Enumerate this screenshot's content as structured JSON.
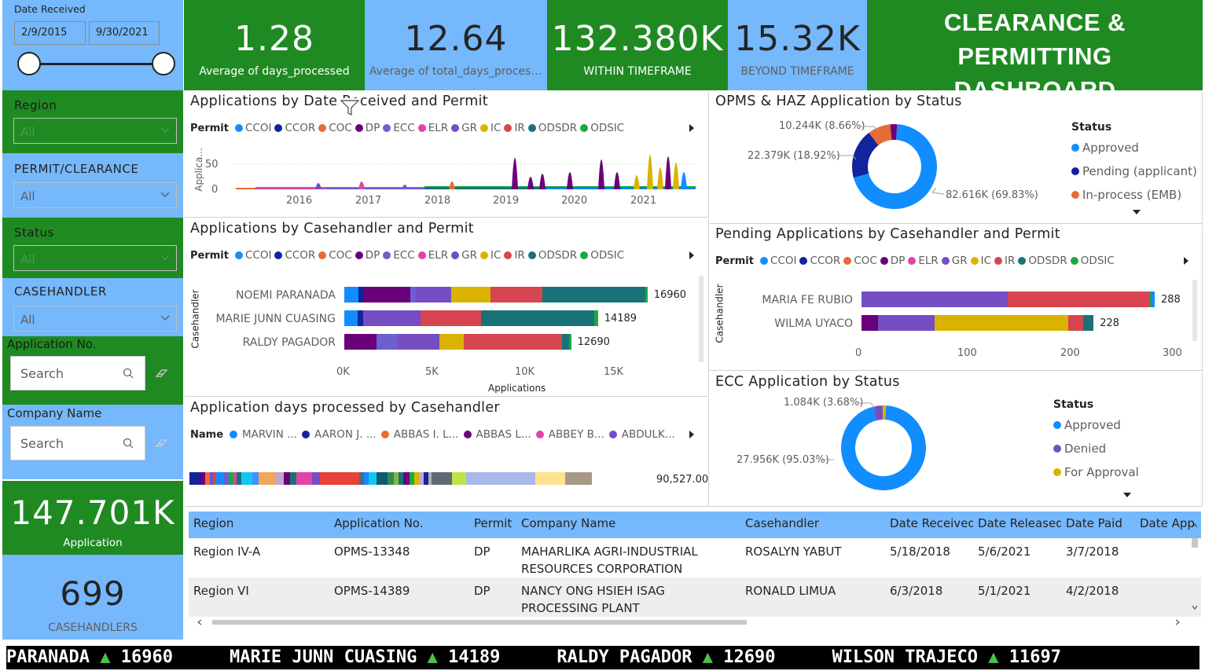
{
  "slicers": {
    "date": {
      "label": "Date Received",
      "start": "2/9/2015",
      "end": "9/30/2021"
    },
    "region": {
      "label": "Region",
      "value": "All"
    },
    "permit": {
      "label": "PERMIT/CLEARANCE",
      "value": "All"
    },
    "status": {
      "label": "Status",
      "value": "All"
    },
    "casehandler": {
      "label": "CASEHANDLER",
      "value": "All"
    },
    "application_no": {
      "label": "Application No.",
      "placeholder": "Search"
    },
    "company_name": {
      "label": "Company Name",
      "placeholder": "Search"
    }
  },
  "kpis": {
    "avg_days": {
      "value": "1.28",
      "label": "Average of days_processed"
    },
    "avg_total_days": {
      "value": "12.64",
      "label": "Average of total_days_processed"
    },
    "within": {
      "value": "132.380K",
      "label": "WITHIN TIMEFRAME"
    },
    "beyond": {
      "value": "15.32K",
      "label": "BEYOND TIMEFRAME"
    },
    "applications": {
      "value": "147.701K",
      "label": "Application"
    },
    "casehandlers": {
      "value": "699",
      "label": "CASEHANDLERS"
    }
  },
  "dashboard_title": "CLEARANCE & PERMITTING DASHBOARD",
  "permit_colors": {
    "CCOI": "#118dff",
    "CCOR": "#12239e",
    "COC": "#e66c37",
    "DP": "#6b007b",
    "ECC": "#6c5fcf",
    "ELR": "#e044a7",
    "GR": "#744ec2",
    "IC": "#d9b300",
    "IR": "#d64550",
    "ODSDR": "#197278",
    "ODSIC": "#1aab40"
  },
  "chart_by_date": {
    "title": "Applications by Date Received and Permit",
    "legend_title": "Permit",
    "legend": [
      "CCOI",
      "CCOR",
      "COC",
      "DP",
      "ECC",
      "ELR",
      "GR",
      "IC",
      "IR",
      "ODSDR",
      "ODSIC"
    ],
    "ylabel": "Applica...",
    "yticks": [
      "50",
      "0"
    ],
    "xticks": [
      "2016",
      "2017",
      "2018",
      "2019",
      "2020",
      "2021"
    ]
  },
  "chart_casehandler": {
    "title": "Applications by Casehandler and Permit",
    "legend_title": "Permit",
    "legend": [
      "CCOI",
      "CCOR",
      "COC",
      "DP",
      "ECC",
      "ELR",
      "GR",
      "IC",
      "IR",
      "ODSDR",
      "ODSIC"
    ],
    "ylabel": "Casehandler",
    "xlabel": "Applications",
    "xticks": [
      "0K",
      "5K",
      "10K",
      "15K"
    ]
  },
  "chart_days": {
    "title": "Application days processed by Casehandler",
    "legend_title": "Name",
    "legend": [
      {
        "name": "MARVIN ...",
        "color": "#118dff"
      },
      {
        "name": "AARON J. ...",
        "color": "#12239e"
      },
      {
        "name": "ABBAS I. L...",
        "color": "#e66c37"
      },
      {
        "name": "ABBAS L...",
        "color": "#6b007b"
      },
      {
        "name": "ABBEY B...",
        "color": "#e044a7"
      },
      {
        "name": "ABDULK...",
        "color": "#744ec2"
      }
    ],
    "total_label": "90,527.00"
  },
  "chart_opms": {
    "title": "OPMS & HAZ Application by Status",
    "legend_title": "Status",
    "legend": [
      {
        "name": "Approved",
        "color": "#118dff"
      },
      {
        "name": "Pending (applicant)",
        "color": "#12239e"
      },
      {
        "name": "In-process (EMB)",
        "color": "#e66c37"
      }
    ],
    "labels": [
      "10.244K (8.66%)",
      "22.379K (18.92%)",
      "82.616K (69.83%)"
    ]
  },
  "chart_pending": {
    "title": "Pending Applications by Casehandler and Permit",
    "legend_title": "Permit",
    "legend": [
      "CCOI",
      "CCOR",
      "COC",
      "DP",
      "ELR",
      "GR",
      "IC",
      "IR",
      "ODSDR",
      "ODSIC"
    ],
    "ylabel": "Casehandler",
    "xticks": [
      "0",
      "100",
      "200",
      "300"
    ]
  },
  "chart_ecc": {
    "title": "ECC Application by Status",
    "legend_title": "Status",
    "legend": [
      {
        "name": "Approved",
        "color": "#118dff"
      },
      {
        "name": "Denied",
        "color": "#744ec2"
      },
      {
        "name": "For Approval",
        "color": "#d9b300"
      }
    ],
    "labels": [
      "1.084K (3.68%)",
      "27.956K (95.03%)"
    ]
  },
  "chart_data": [
    {
      "type": "bar",
      "title": "Applications by Casehandler and Permit",
      "orientation": "horizontal-stacked",
      "categories": [
        "NOEMI PARANADA",
        "MARIE JUNN CUASING",
        "RALDY PAGADOR"
      ],
      "totals": [
        16960,
        14189,
        12690
      ],
      "segments": [
        [
          {
            "p": "CCOI",
            "v": 800
          },
          {
            "p": "CCOR",
            "v": 300
          },
          {
            "p": "DP",
            "v": 2600
          },
          {
            "p": "ECC",
            "v": 300
          },
          {
            "p": "GR",
            "v": 2000
          },
          {
            "p": "IC",
            "v": 2200
          },
          {
            "p": "IR",
            "v": 2900
          },
          {
            "p": "ODSDR",
            "v": 5760
          },
          {
            "p": "ODSIC",
            "v": 100
          }
        ],
        [
          {
            "p": "CCOI",
            "v": 750
          },
          {
            "p": "CCOR",
            "v": 300
          },
          {
            "p": "GR",
            "v": 3200
          },
          {
            "p": "IR",
            "v": 3400
          },
          {
            "p": "ODSDR",
            "v": 6339
          },
          {
            "p": "ODSIC",
            "v": 200
          }
        ],
        [
          {
            "p": "DP",
            "v": 1800
          },
          {
            "p": "ECC",
            "v": 1200
          },
          {
            "p": "GR",
            "v": 2300
          },
          {
            "p": "IC",
            "v": 1400
          },
          {
            "p": "IR",
            "v": 5490
          },
          {
            "p": "ODSDR",
            "v": 400
          },
          {
            "p": "ODSIC",
            "v": 100
          }
        ]
      ],
      "xlim": [
        0,
        17500
      ]
    },
    {
      "type": "bar",
      "title": "Pending Applications by Casehandler and Permit",
      "orientation": "horizontal-stacked",
      "categories": [
        "MARIA FE RUBIO",
        "WILMA UYACO"
      ],
      "totals": [
        288,
        228
      ],
      "segments": [
        [
          {
            "p": "GR",
            "v": 144
          },
          {
            "p": "IR",
            "v": 139
          },
          {
            "p": "ODSIC",
            "v": 1
          },
          {
            "p": "CCOI",
            "v": 4
          }
        ],
        [
          {
            "p": "DP",
            "v": 16
          },
          {
            "p": "GR",
            "v": 56
          },
          {
            "p": "IC",
            "v": 131
          },
          {
            "p": "IR",
            "v": 15
          },
          {
            "p": "ODSDR",
            "v": 10
          }
        ]
      ],
      "xlim": [
        0,
        305
      ]
    },
    {
      "type": "pie",
      "title": "OPMS & HAZ Application by Status",
      "slices": [
        {
          "name": "Approved",
          "value": 82616,
          "color": "#118dff"
        },
        {
          "name": "Pending (applicant)",
          "value": 22379,
          "color": "#12239e"
        },
        {
          "name": "In-process (EMB)",
          "value": 10244,
          "color": "#e66c37"
        },
        {
          "name": "Other",
          "value": 3071,
          "color": "#6b007b"
        }
      ]
    },
    {
      "type": "pie",
      "title": "ECC Application by Status",
      "slices": [
        {
          "name": "Approved",
          "value": 27956,
          "color": "#118dff"
        },
        {
          "name": "Denied",
          "value": 1084,
          "color": "#744ec2"
        },
        {
          "name": "For Approval",
          "value": 380,
          "color": "#d9b300"
        }
      ]
    }
  ],
  "table": {
    "columns": [
      "Region",
      "Application No.",
      "Permit",
      "Company Name",
      "Casehandler",
      "Date Received",
      "Date Released",
      "Date Paid",
      "Date App"
    ],
    "rows": [
      [
        "Region IV-A",
        "OPMS-13348",
        "DP",
        "MAHARLIKA AGRI-INDUSTRIAL RESOURCES CORPORATION",
        "ROSALYN YABUT",
        "5/18/2018",
        "5/6/2021",
        "3/7/2018",
        ""
      ],
      [
        "Region VI",
        "OPMS-14389",
        "DP",
        "NANCY ONG HSIEH ISAG PROCESSING PLANT",
        "RONALD LIMUA",
        "6/3/2018",
        "5/1/2021",
        "4/2/2018",
        ""
      ]
    ]
  },
  "ticker": [
    {
      "name": "PARANADA",
      "value": "16960"
    },
    {
      "name": "MARIE JUNN CUASING",
      "value": "14189"
    },
    {
      "name": "RALDY PAGADOR",
      "value": "12690"
    },
    {
      "name": "WILSON TRAJECO",
      "value": "11697"
    }
  ]
}
